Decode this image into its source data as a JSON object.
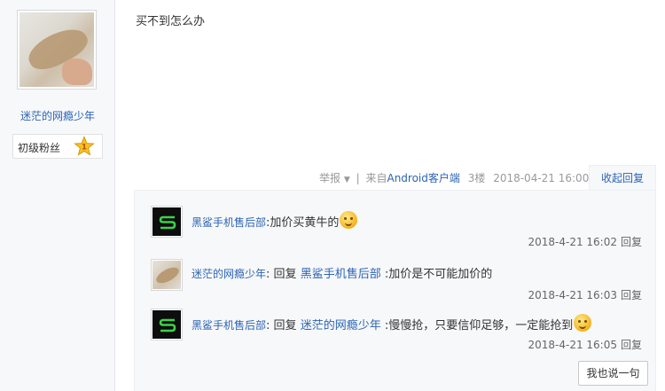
{
  "author": {
    "username": "迷茫的网瘾少年",
    "level_title": "初级粉丝",
    "level_number": "1"
  },
  "post": {
    "content": "买不到怎么办"
  },
  "meta": {
    "report": "举报",
    "source_prefix": "来自",
    "source_link": "Android客户端",
    "floor": "3楼",
    "datetime": "2018-04-21 16:00",
    "toggle_label": "收起回复"
  },
  "replies": [
    {
      "author": "黑鲨手机售后部",
      "avatar_icon": "shark-s-logo-icon",
      "reply_prefix": "",
      "target": "",
      "text": "加价买黄牛的",
      "has_emoji": true,
      "time": "2018-4-21 16:02",
      "reply_link": "回复"
    },
    {
      "author": "迷茫的网瘾少年",
      "avatar_icon": "leaf-photo-avatar",
      "reply_prefix": "回复",
      "target": "黑鲨手机售后部",
      "text": "加价是不可能加价的",
      "has_emoji": false,
      "time": "2018-4-21 16:03",
      "reply_link": "回复"
    },
    {
      "author": "黑鲨手机售后部",
      "avatar_icon": "shark-s-logo-icon",
      "reply_prefix": "回复",
      "target": "迷茫的网瘾少年",
      "text": "慢慢抢，只要信仰足够，一定能抢到",
      "has_emoji": true,
      "time": "2018-4-21 16:05",
      "reply_link": "回复"
    }
  ],
  "composer": {
    "say_button": "我也说一句"
  },
  "colors": {
    "link": "#2d64b3",
    "panel_bg": "#f7f8fa",
    "shark_green": "#3ad34a"
  }
}
